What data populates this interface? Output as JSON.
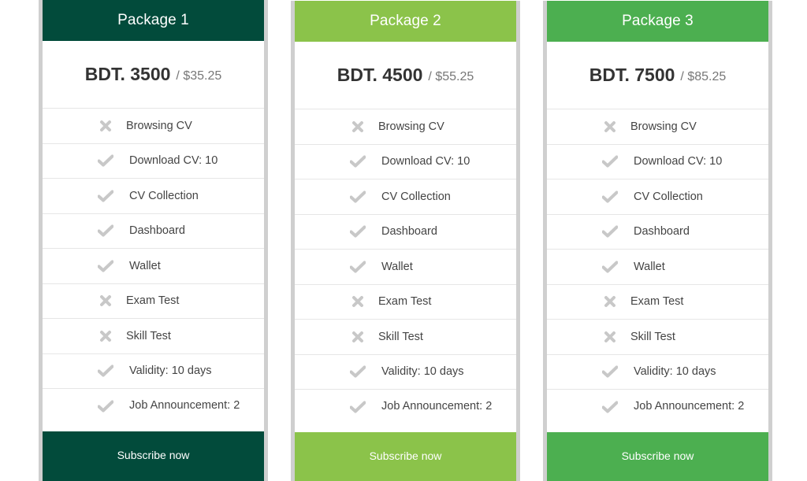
{
  "packages": [
    {
      "title": "Package 1",
      "price": "BDT. 3500",
      "price_usd": "/ $35.25",
      "accent": "#024b3b",
      "button_label": "Subscribe now",
      "features": [
        {
          "label": "Browsing CV",
          "included": false,
          "icon": "times-icon"
        },
        {
          "label": "Download CV: 10",
          "included": true,
          "icon": "check-icon"
        },
        {
          "label": "CV Collection",
          "included": true,
          "icon": "check-icon"
        },
        {
          "label": "Dashboard",
          "included": true,
          "icon": "check-icon"
        },
        {
          "label": "Wallet",
          "included": true,
          "icon": "check-icon"
        },
        {
          "label": "Exam Test",
          "included": false,
          "icon": "times-icon"
        },
        {
          "label": "Skill Test",
          "included": false,
          "icon": "times-icon"
        },
        {
          "label": "Validity: 10 days",
          "included": true,
          "icon": "check-icon"
        },
        {
          "label": "Job Announcement: 2",
          "included": true,
          "icon": "check-icon"
        }
      ]
    },
    {
      "title": "Package 2",
      "price": "BDT. 4500",
      "price_usd": "/ $55.25",
      "accent": "#8bc34a",
      "button_label": "Subscribe now",
      "features": [
        {
          "label": "Browsing CV",
          "included": false,
          "icon": "times-icon"
        },
        {
          "label": "Download CV: 10",
          "included": true,
          "icon": "check-icon"
        },
        {
          "label": "CV Collection",
          "included": true,
          "icon": "check-icon"
        },
        {
          "label": "Dashboard",
          "included": true,
          "icon": "check-icon"
        },
        {
          "label": "Wallet",
          "included": true,
          "icon": "check-icon"
        },
        {
          "label": "Exam Test",
          "included": false,
          "icon": "times-icon"
        },
        {
          "label": "Skill Test",
          "included": false,
          "icon": "times-icon"
        },
        {
          "label": "Validity: 10 days",
          "included": true,
          "icon": "check-icon"
        },
        {
          "label": "Job Announcement: 2",
          "included": true,
          "icon": "check-icon"
        }
      ]
    },
    {
      "title": "Package 3",
      "price": "BDT. 7500",
      "price_usd": "/ $85.25",
      "accent": "#4caf50",
      "button_label": "Subscribe now",
      "features": [
        {
          "label": "Browsing CV",
          "included": false,
          "icon": "times-icon"
        },
        {
          "label": "Download CV: 10",
          "included": true,
          "icon": "check-icon"
        },
        {
          "label": "CV Collection",
          "included": true,
          "icon": "check-icon"
        },
        {
          "label": "Dashboard",
          "included": true,
          "icon": "check-icon"
        },
        {
          "label": "Wallet",
          "included": true,
          "icon": "check-icon"
        },
        {
          "label": "Exam Test",
          "included": false,
          "icon": "times-icon"
        },
        {
          "label": "Skill Test",
          "included": false,
          "icon": "times-icon"
        },
        {
          "label": "Validity: 10 days",
          "included": true,
          "icon": "check-icon"
        },
        {
          "label": "Job Announcement: 2",
          "included": true,
          "icon": "check-icon"
        }
      ]
    }
  ],
  "icon_color": "#c8c8c8"
}
